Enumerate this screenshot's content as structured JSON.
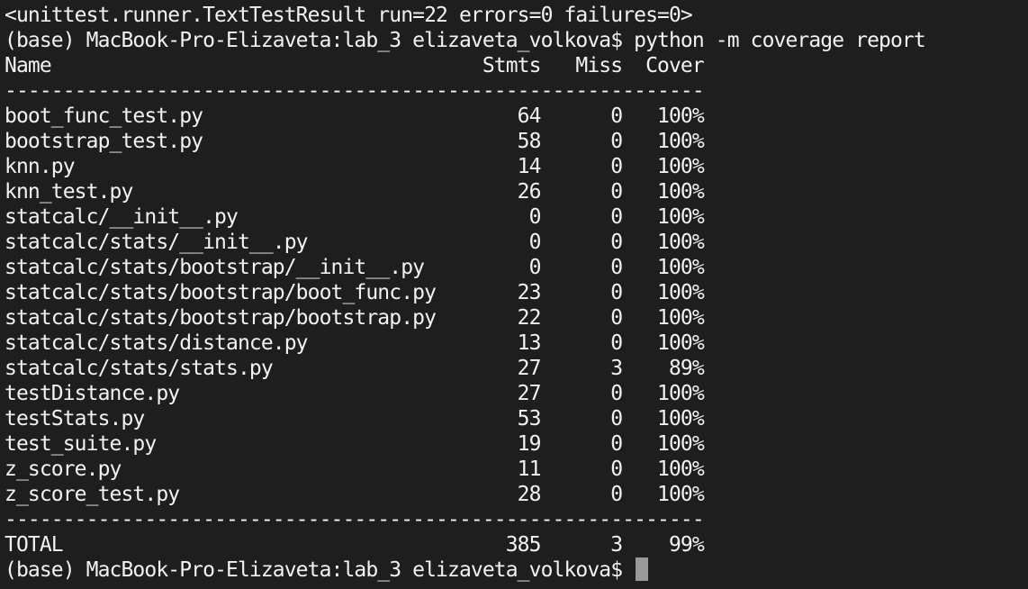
{
  "terminal": {
    "colors": {
      "background": "#1e1e1e",
      "foreground": "#f2f2f2",
      "cursor": "#9a9a9a"
    },
    "lines": [
      "<unittest.runner.TextTestResult run=22 errors=0 failures=0>",
      "(base) MacBook-Pro-Elizaveta:lab_3 elizaveta_volkova$ python -m coverage report",
      "Name                                     Stmts   Miss  Cover",
      "------------------------------------------------------------",
      "boot_func_test.py                           64      0   100%",
      "bootstrap_test.py                           58      0   100%",
      "knn.py                                      14      0   100%",
      "knn_test.py                                 26      0   100%",
      "statcalc/__init__.py                         0      0   100%",
      "statcalc/stats/__init__.py                   0      0   100%",
      "statcalc/stats/bootstrap/__init__.py         0      0   100%",
      "statcalc/stats/bootstrap/boot_func.py       23      0   100%",
      "statcalc/stats/bootstrap/bootstrap.py       22      0   100%",
      "statcalc/stats/distance.py                  13      0   100%",
      "statcalc/stats/stats.py                     27      3    89%",
      "testDistance.py                             27      0   100%",
      "testStats.py                                53      0   100%",
      "test_suite.py                               19      0   100%",
      "z_score.py                                  11      0   100%",
      "z_score_test.py                             28      0   100%",
      "------------------------------------------------------------",
      "TOTAL                                      385      3    99%"
    ],
    "prompt": "(base) MacBook-Pro-Elizaveta:lab_3 elizaveta_volkova$ "
  }
}
